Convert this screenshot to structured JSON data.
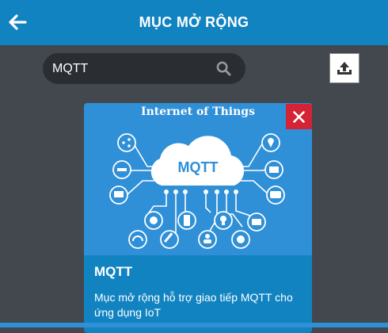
{
  "header": {
    "title": "MỤC MỞ RỘNG",
    "back_icon": "arrow-left-icon"
  },
  "search": {
    "value": "MQTT",
    "icon": "search-icon"
  },
  "upload": {
    "icon": "upload-icon"
  },
  "card": {
    "image_title": "Internet of Things",
    "cloud_label": "MQTT",
    "title": "MQTT",
    "description": "Mục mở rộng hỗ trợ giao tiếp MQTT cho ứng dụng IoT",
    "close_icon": "close-icon"
  },
  "colors": {
    "header": "#1183c1",
    "card_image": "#2f8fd7",
    "close": "#d32335",
    "background": "#42484e"
  }
}
